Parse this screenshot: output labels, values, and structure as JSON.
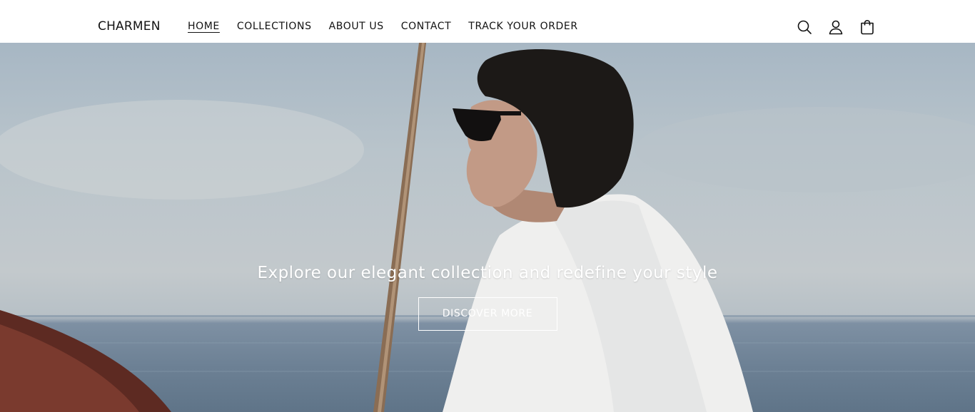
{
  "header": {
    "logo": "CHARMEN",
    "nav": [
      {
        "label": "HOME",
        "active": true
      },
      {
        "label": "COLLECTIONS",
        "active": false
      },
      {
        "label": "ABOUT US",
        "active": false
      },
      {
        "label": "CONTACT",
        "active": false
      },
      {
        "label": "TRACK YOUR ORDER",
        "active": false
      }
    ],
    "icons": [
      "search-icon",
      "account-icon",
      "cart-icon"
    ]
  },
  "hero": {
    "heading": "Explore our elegant collection and redefine your style",
    "button_label": "DISCOVER MORE"
  },
  "colors": {
    "text": "#121212",
    "header_bg": "#ffffff",
    "hero_text": "#ffffff"
  }
}
